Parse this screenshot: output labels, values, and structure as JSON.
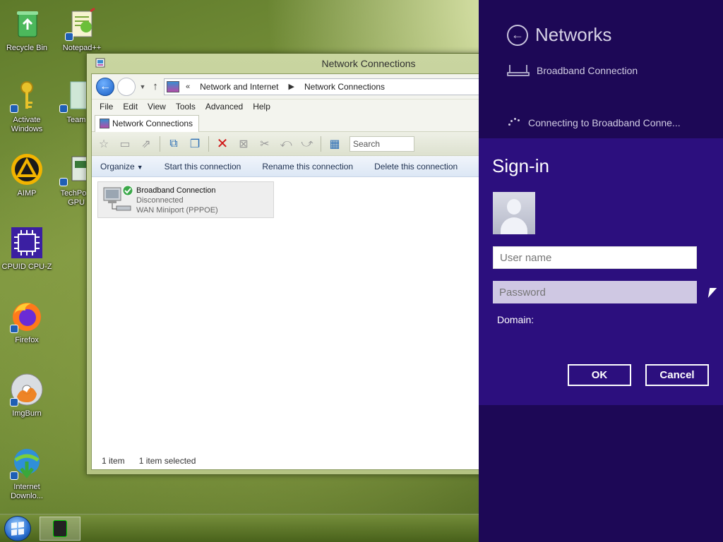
{
  "desktop": {
    "icons": [
      {
        "label": "Recycle Bin"
      },
      {
        "label": "Notepad++"
      },
      {
        "label": "Activate Windows"
      },
      {
        "label": "Team"
      },
      {
        "label": "AIMP"
      },
      {
        "label": "TechPow GPU"
      },
      {
        "label": "CPUID CPU-Z"
      },
      {
        "label": "Firefox"
      },
      {
        "label": "ImgBurn"
      },
      {
        "label": "Internet Downlo..."
      }
    ]
  },
  "explorer": {
    "title": "Network Connections",
    "address": {
      "overflow": "«",
      "crumbs": [
        "Network and Internet",
        "Network Connections"
      ]
    },
    "menu": [
      "File",
      "Edit",
      "View",
      "Tools",
      "Advanced",
      "Help"
    ],
    "tab": "Network Connections",
    "search_placeholder": "Search",
    "commands": [
      "Organize",
      "Start this connection",
      "Rename this connection",
      "Delete this connection"
    ],
    "item": {
      "name": "Broadband Connection",
      "status": "Disconnected",
      "device": "WAN Miniport (PPPOE)"
    },
    "status_bar": {
      "count": "1 item",
      "selection": "1 item selected"
    }
  },
  "networks_pane": {
    "title": "Networks",
    "network_name": "Broadband Connection",
    "connecting_text": "Connecting to Broadband Conne...",
    "signin": {
      "title": "Sign-in",
      "username_placeholder": "User name",
      "password_placeholder": "Password",
      "domain_label": "Domain:",
      "ok_label": "OK",
      "cancel_label": "Cancel"
    }
  }
}
